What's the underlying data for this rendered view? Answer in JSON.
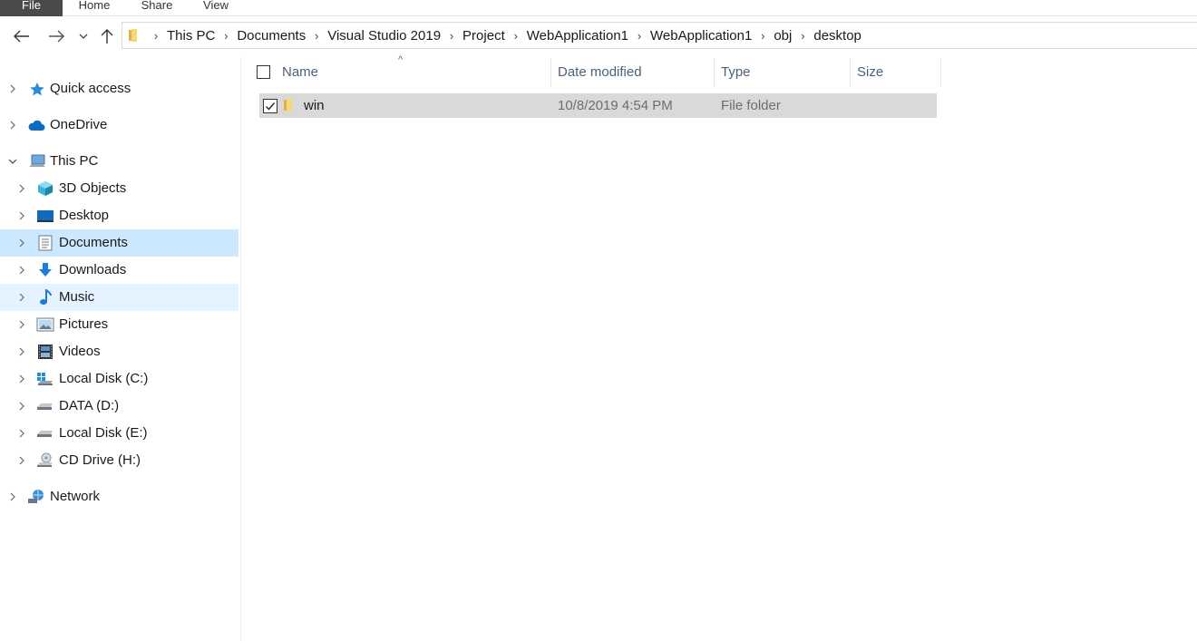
{
  "ribbon": {
    "tabs": [
      "File",
      "Home",
      "Share",
      "View"
    ]
  },
  "navigation": {
    "back_icon": "arrow-left-icon",
    "forward_icon": "arrow-right-icon",
    "recent_icon": "chevron-down-icon",
    "up_icon": "arrow-up-icon"
  },
  "address": {
    "breadcrumbs": [
      "This PC",
      "Documents",
      "Visual Studio 2019",
      "Project",
      "WebApplication1",
      "WebApplication1",
      "obj",
      "desktop"
    ]
  },
  "sidebar": {
    "items": [
      {
        "label": "Quick access",
        "icon": "star-icon",
        "state": "normal"
      },
      {
        "label": "OneDrive",
        "icon": "cloud-icon",
        "state": "normal"
      },
      {
        "label": "This PC",
        "icon": "computer-icon",
        "state": "expanded"
      },
      {
        "label": "3D Objects",
        "icon": "cube-icon",
        "state": "normal"
      },
      {
        "label": "Desktop",
        "icon": "desktop-icon",
        "state": "normal"
      },
      {
        "label": "Documents",
        "icon": "document-icon",
        "state": "selected"
      },
      {
        "label": "Downloads",
        "icon": "download-icon",
        "state": "normal"
      },
      {
        "label": "Music",
        "icon": "music-note-icon",
        "state": "hover"
      },
      {
        "label": "Pictures",
        "icon": "picture-icon",
        "state": "normal"
      },
      {
        "label": "Videos",
        "icon": "film-icon",
        "state": "normal"
      },
      {
        "label": "Local Disk (C:)",
        "icon": "system-drive-icon",
        "state": "normal"
      },
      {
        "label": "DATA (D:)",
        "icon": "drive-icon",
        "state": "normal"
      },
      {
        "label": "Local Disk (E:)",
        "icon": "drive-icon",
        "state": "normal"
      },
      {
        "label": "CD Drive (H:)",
        "icon": "cd-drive-icon",
        "state": "normal"
      },
      {
        "label": "Network",
        "icon": "network-icon",
        "state": "normal"
      }
    ]
  },
  "columns": {
    "name": "Name",
    "date": "Date modified",
    "type": "Type",
    "size": "Size"
  },
  "files": [
    {
      "name": "win",
      "date": "10/8/2019 4:54 PM",
      "type": "File folder",
      "size": "",
      "selected": true
    }
  ],
  "colors": {
    "selected_bg": "#cce8ff",
    "hover_bg": "#e5f3ff",
    "row_selected_bg": "#d9d9d9",
    "header_text": "#4c607a",
    "folder_yellow": "#f8d775"
  }
}
